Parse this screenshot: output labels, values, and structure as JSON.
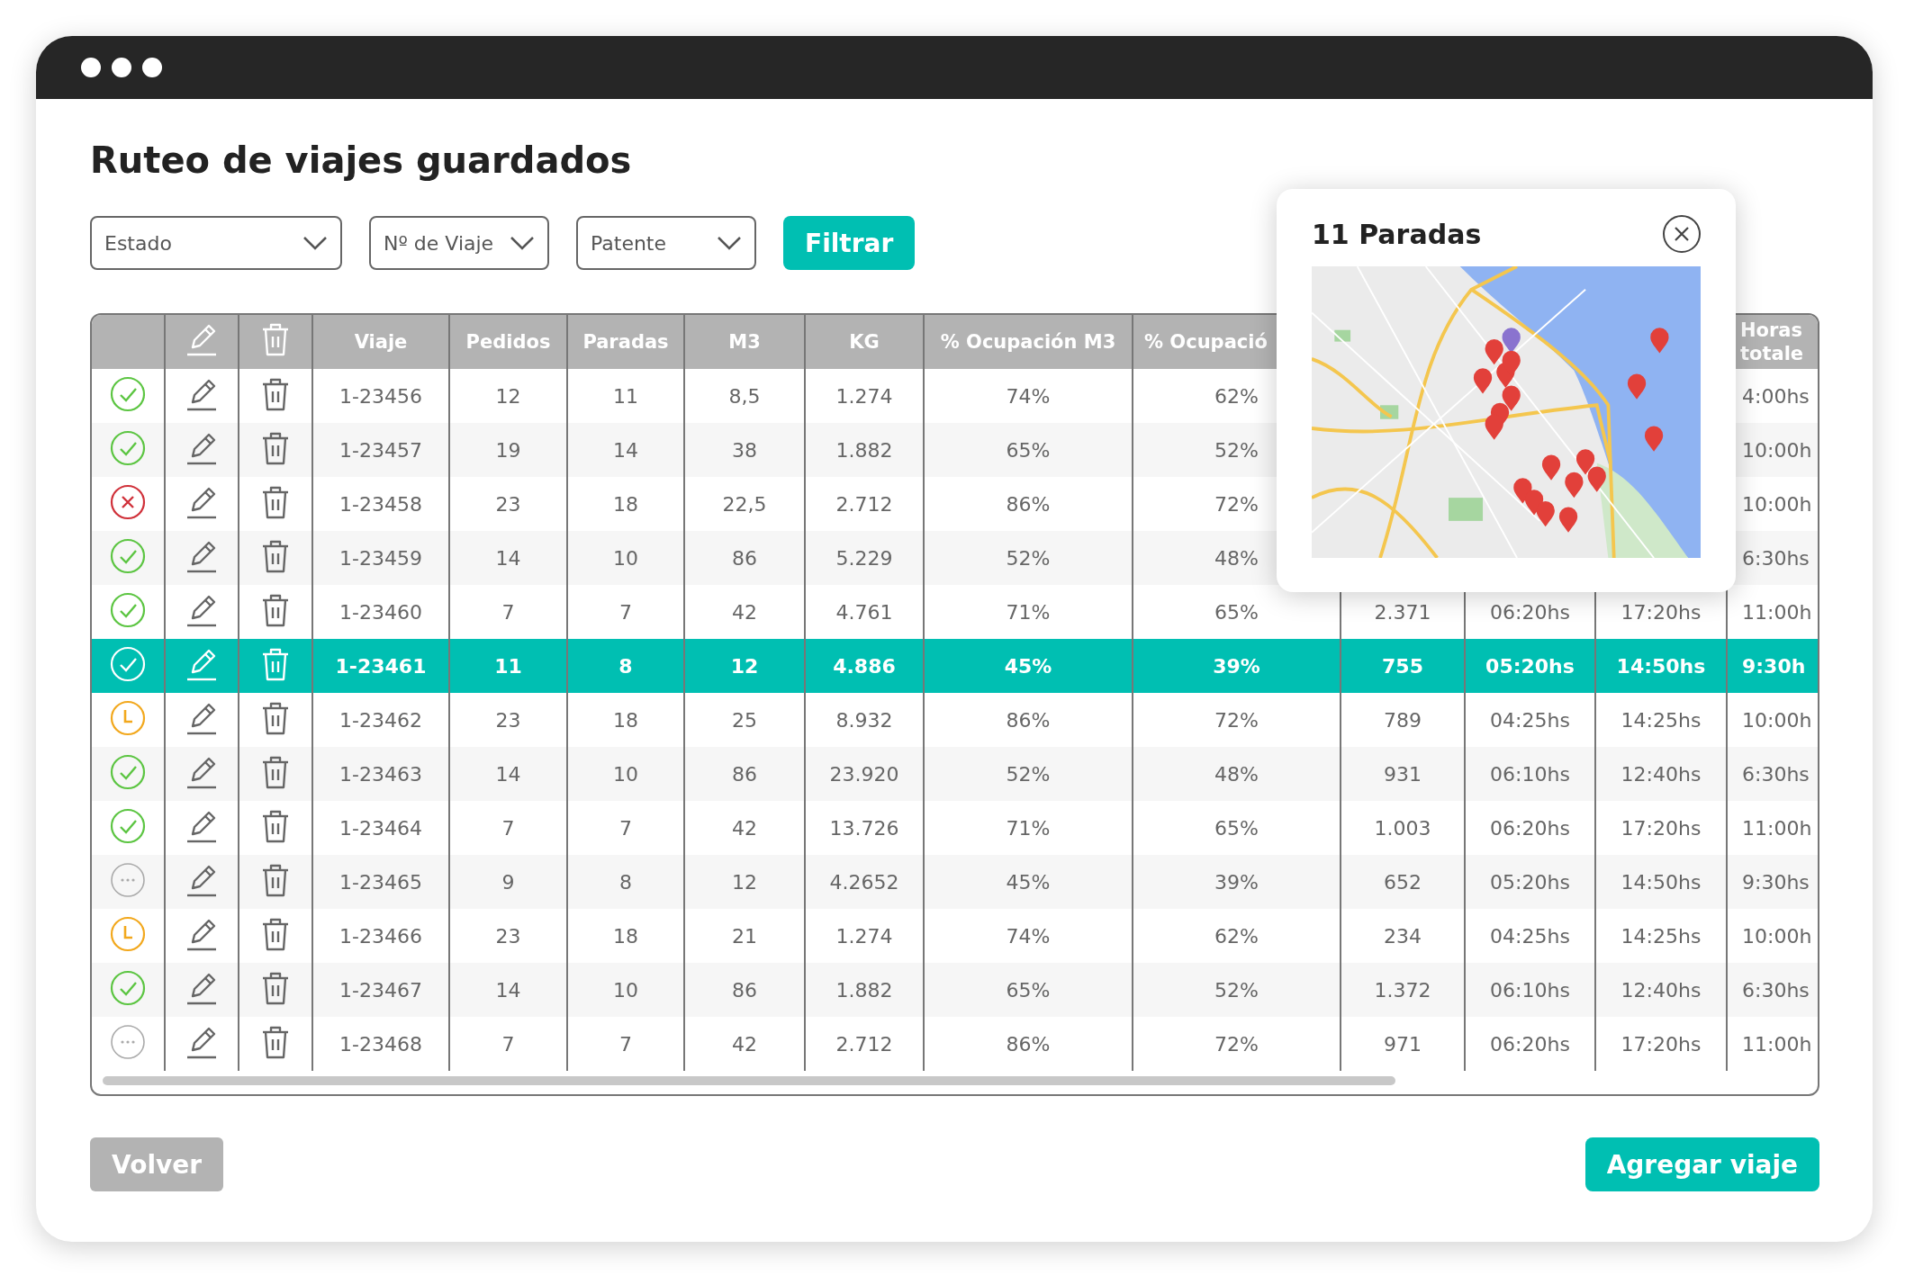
{
  "title": "Ruteo de viajes guardados",
  "filters": [
    {
      "label": "Estado"
    },
    {
      "label": "Nº de Viaje"
    },
    {
      "label": "Patente"
    }
  ],
  "filter_button": "Filtrar",
  "table": {
    "columns": [
      "Viaje",
      "Pedidos",
      "Paradas",
      "M3",
      "KG",
      "% Ocupación M3",
      "% Ocupació",
      null,
      null,
      null,
      "Horas totale"
    ],
    "rows": [
      {
        "kind": "ok",
        "selected": false,
        "cells": [
          "1-23456",
          "12",
          "11",
          "8,5",
          "1.274",
          "74%",
          "62%",
          null,
          null,
          null,
          "4:00hs"
        ]
      },
      {
        "kind": "ok",
        "selected": false,
        "cells": [
          "1-23457",
          "19",
          "14",
          "38",
          "1.882",
          "65%",
          "52%",
          null,
          null,
          null,
          "10:00h"
        ]
      },
      {
        "kind": "error",
        "selected": false,
        "cells": [
          "1-23458",
          "23",
          "18",
          "22,5",
          "2.712",
          "86%",
          "72%",
          null,
          null,
          null,
          "10:00h"
        ]
      },
      {
        "kind": "ok",
        "selected": false,
        "cells": [
          "1-23459",
          "14",
          "10",
          "86",
          "5.229",
          "52%",
          "48%",
          null,
          null,
          null,
          "6:30hs"
        ]
      },
      {
        "kind": "ok",
        "selected": false,
        "cells": [
          "1-23460",
          "7",
          "7",
          "42",
          "4.761",
          "71%",
          "65%",
          "2.371",
          "06:20hs",
          "17:20hs",
          "11:00h"
        ]
      },
      {
        "kind": "ok",
        "selected": true,
        "cells": [
          "1-23461",
          "11",
          "8",
          "12",
          "4.886",
          "45%",
          "39%",
          "755",
          "05:20hs",
          "14:50hs",
          "9:30h"
        ]
      },
      {
        "kind": "pending",
        "selected": false,
        "cells": [
          "1-23462",
          "23",
          "18",
          "25",
          "8.932",
          "86%",
          "72%",
          "789",
          "04:25hs",
          "14:25hs",
          "10:00h"
        ]
      },
      {
        "kind": "ok",
        "selected": false,
        "cells": [
          "1-23463",
          "14",
          "10",
          "86",
          "23.920",
          "52%",
          "48%",
          "931",
          "06:10hs",
          "12:40hs",
          "6:30hs"
        ]
      },
      {
        "kind": "ok",
        "selected": false,
        "cells": [
          "1-23464",
          "7",
          "7",
          "42",
          "13.726",
          "71%",
          "65%",
          "1.003",
          "06:20hs",
          "17:20hs",
          "11:00h"
        ]
      },
      {
        "kind": "draft",
        "selected": false,
        "cells": [
          "1-23465",
          "9",
          "8",
          "12",
          "4.2652",
          "45%",
          "39%",
          "652",
          "05:20hs",
          "14:50hs",
          "9:30hs"
        ]
      },
      {
        "kind": "pending",
        "selected": false,
        "cells": [
          "1-23466",
          "23",
          "18",
          "21",
          "1.274",
          "74%",
          "62%",
          "234",
          "04:25hs",
          "14:25hs",
          "10:00h"
        ]
      },
      {
        "kind": "ok",
        "selected": false,
        "cells": [
          "1-23467",
          "14",
          "10",
          "86",
          "1.882",
          "65%",
          "52%",
          "1.372",
          "06:10hs",
          "12:40hs",
          "6:30hs"
        ]
      },
      {
        "kind": "draft",
        "selected": false,
        "cells": [
          "1-23468",
          "7",
          "7",
          "42",
          "2.712",
          "86%",
          "72%",
          "971",
          "06:20hs",
          "17:20hs",
          "11:00h"
        ]
      }
    ]
  },
  "popup": {
    "title": "11 Paradas"
  },
  "buttons": {
    "back": "Volver",
    "add": "Agregar viaje"
  }
}
